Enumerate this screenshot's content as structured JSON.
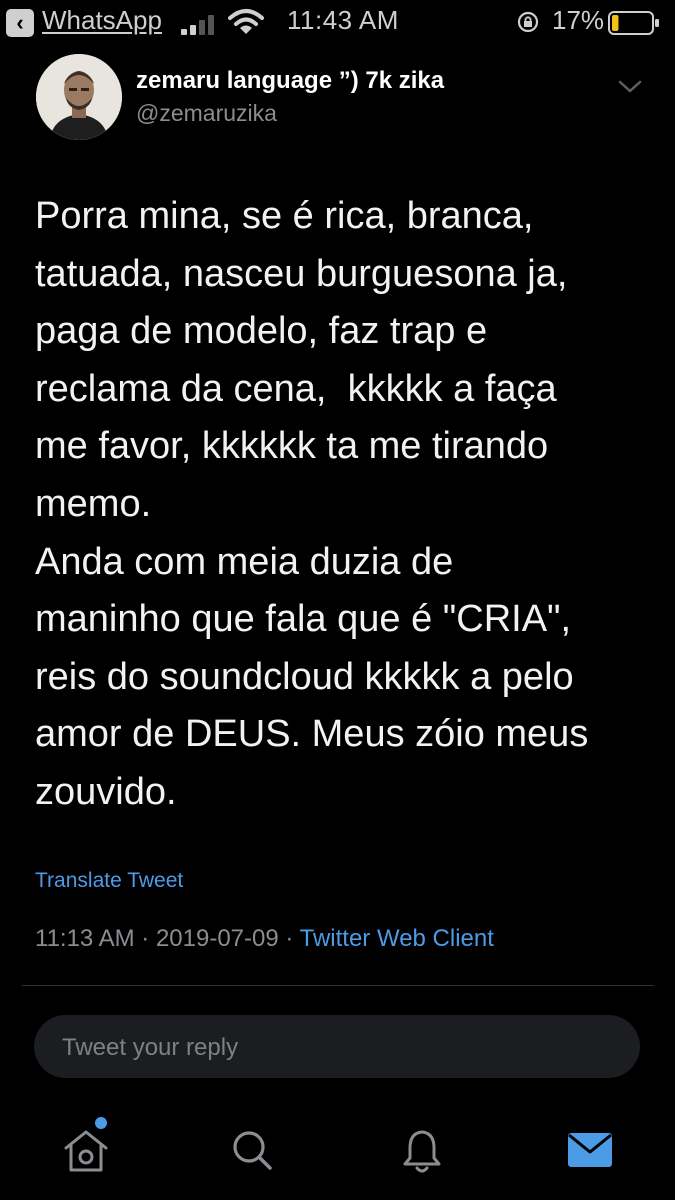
{
  "status_bar": {
    "back_app": "WhatsApp",
    "time": "11:43 AM",
    "battery_percent": "17%",
    "battery_level": 0.17
  },
  "tweet": {
    "display_name": "zemaru language ”) 7k zika",
    "handle": "@zemaruzika",
    "lines": [
      "Porra mina, se é rica, branca,",
      "tatuada, nasceu burguesona ja,",
      "paga de modelo, faz trap e",
      "reclama da cena,  kkkkk a faça",
      "me favor, kkkkkk ta me tirando",
      "memo.",
      "Anda com meia duzia de",
      "maninho que fala que é \"CRIA\",",
      "reis do soundcloud kkkkk a pelo",
      "amor de DEUS. Meus zóio meus",
      "zouvido."
    ],
    "translate_label": "Translate Tweet",
    "time": "11:13 AM",
    "separator": " · ",
    "date": "2019-07-09",
    "client": "Twitter Web Client"
  },
  "reply": {
    "placeholder": "Tweet your reply",
    "value": ""
  },
  "tab_bar": {
    "items": [
      "home-icon",
      "search-icon",
      "bell-icon",
      "mail-icon"
    ],
    "active": "mail-icon",
    "accent": "#4c9be6",
    "has_unread_home": true
  },
  "colors": {
    "background": "#000000",
    "link": "#4c9be6",
    "muted": "#8a8d91"
  }
}
